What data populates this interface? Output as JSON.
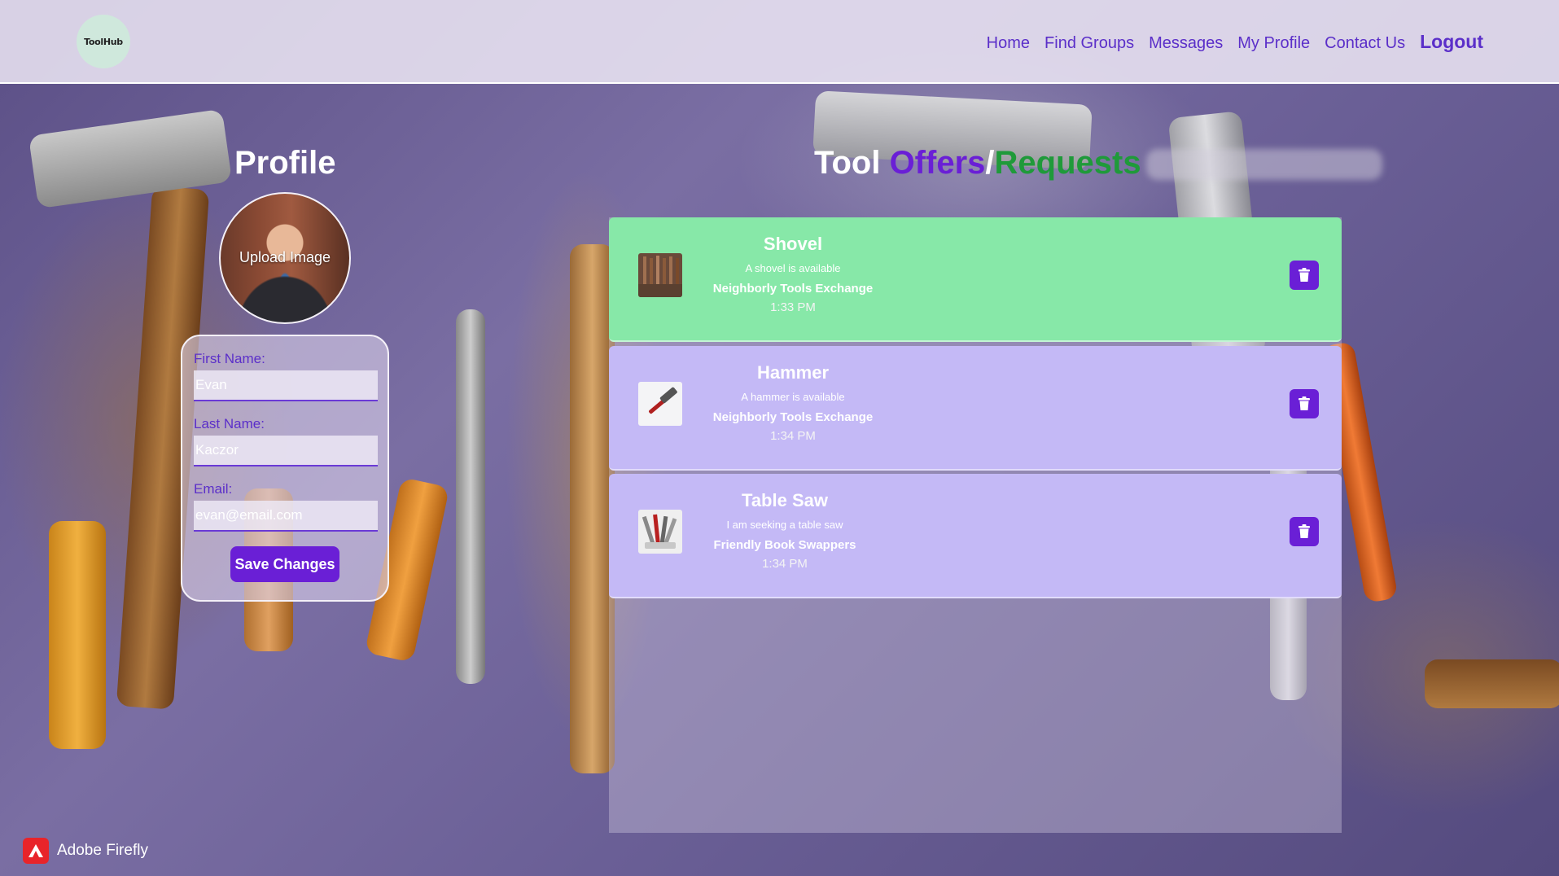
{
  "app": {
    "logo_text": "ToolHub"
  },
  "nav": {
    "items": [
      "Home",
      "Find Groups",
      "Messages",
      "My Profile",
      "Contact Us"
    ],
    "logout": "Logout"
  },
  "profile": {
    "title": "Profile",
    "upload_label": "Upload Image",
    "first_name_label": "First Name:",
    "first_name_value": "Evan",
    "last_name_label": "Last Name:",
    "last_name_value": "Kaczor",
    "email_label": "Email:",
    "email_value": "evan@email.com",
    "save_label": "Save Changes"
  },
  "listings": {
    "title_prefix": "Tool ",
    "title_offers": "Offers",
    "title_sep": "/",
    "title_requests": "Requests",
    "items": [
      {
        "type": "offer",
        "name": "Shovel",
        "description": "A shovel is available",
        "group": "Neighborly Tools Exchange",
        "time": "1:33 PM",
        "thumb_icon": "shovel-thumbnail"
      },
      {
        "type": "request",
        "name": "Hammer",
        "description": "A hammer is available",
        "group": "Neighborly Tools Exchange",
        "time": "1:34 PM",
        "thumb_icon": "hammer-thumbnail"
      },
      {
        "type": "request",
        "name": "Table Saw",
        "description": "I am seeking a table saw",
        "group": "Friendly Book Swappers",
        "time": "1:34 PM",
        "thumb_icon": "table-saw-thumbnail"
      }
    ]
  },
  "footer": {
    "badge": "Adobe Firefly"
  },
  "colors": {
    "accent": "#6a1fd6",
    "nav_text": "#5b2fc9",
    "offer_bg": "#87e8a8",
    "request_bg": "#c4b9f6",
    "requests_text": "#1f9a3a"
  }
}
